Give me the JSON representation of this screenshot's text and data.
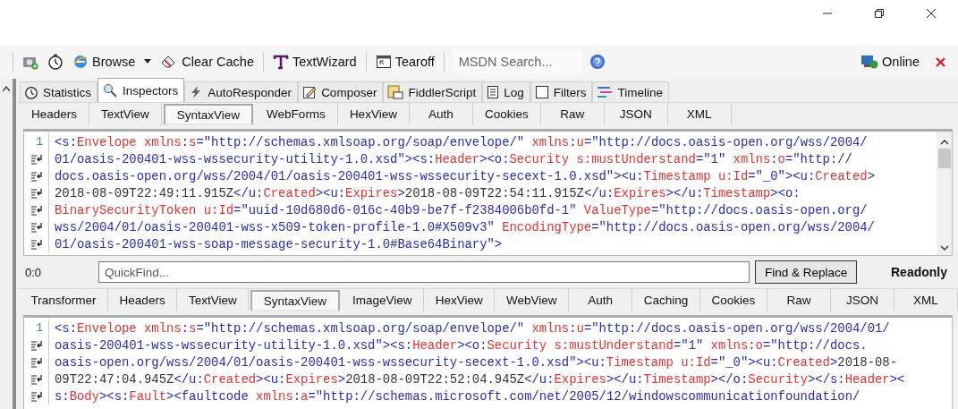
{
  "toolbar": {
    "items": [
      {
        "kind": "icon"
      },
      {
        "kind": "icon"
      },
      {
        "kind": "dropdown",
        "label": "Browse"
      },
      {
        "kind": "button",
        "label": "Clear Cache"
      },
      {
        "kind": "button",
        "label": "TextWizard"
      },
      {
        "kind": "button",
        "label": "Tearoff"
      }
    ],
    "search": {
      "placeholder": "MSDN Search..."
    },
    "status": {
      "label": "Online"
    }
  },
  "main_tabs": [
    {
      "label": "Statistics",
      "selected": false
    },
    {
      "label": "Inspectors",
      "selected": true
    },
    {
      "label": "AutoResponder",
      "selected": false
    },
    {
      "label": "Composer",
      "selected": false
    },
    {
      "label": "FiddlerScript",
      "selected": false
    },
    {
      "label": "Log",
      "selected": false
    },
    {
      "label": "Filters",
      "selected": false
    },
    {
      "label": "Timeline",
      "selected": false
    }
  ],
  "request": {
    "tabs": [
      {
        "label": "Headers",
        "selected": false
      },
      {
        "label": "TextView",
        "selected": false
      },
      {
        "label": "SyntaxView",
        "selected": true
      },
      {
        "label": "WebForms",
        "selected": false
      },
      {
        "label": "HexView",
        "selected": false
      },
      {
        "label": "Auth",
        "selected": false
      },
      {
        "label": "Cookies",
        "selected": false
      },
      {
        "label": "Raw",
        "selected": false
      },
      {
        "label": "JSON",
        "selected": false
      },
      {
        "label": "XML",
        "selected": false
      }
    ],
    "lines": [
      {
        "number": "1",
        "tokens": [
          {
            "kind": "markup",
            "text": "<s:"
          },
          {
            "kind": "name",
            "text": "Envelope xmlns"
          },
          {
            "kind": "markup",
            "text": ":"
          },
          {
            "kind": "name",
            "text": "s"
          },
          {
            "kind": "markup",
            "text": "=\"http://schemas.xmlsoap.org/soap/envelope/\""
          },
          {
            "kind": "name",
            "text": " xmlns"
          },
          {
            "kind": "markup",
            "text": ":"
          },
          {
            "kind": "name",
            "text": "u"
          },
          {
            "kind": "markup",
            "text": "=\"http://docs.oasis-open.org/wss/2004/"
          }
        ]
      },
      {
        "wrapped": true,
        "tokens": [
          {
            "kind": "markup",
            "text": "01/oasis-200401-wss-wssecurity-utility-1.0.xsd\"><s:"
          },
          {
            "kind": "name",
            "text": "Header"
          },
          {
            "kind": "markup",
            "text": "><o:"
          },
          {
            "kind": "name",
            "text": "Security s:mustUnderstand"
          },
          {
            "kind": "markup",
            "text": "=\"1\""
          },
          {
            "kind": "name",
            "text": " xmlns"
          },
          {
            "kind": "markup",
            "text": ":"
          },
          {
            "kind": "name",
            "text": "o"
          },
          {
            "kind": "markup",
            "text": "=\"http://"
          }
        ]
      },
      {
        "wrapped": true,
        "tokens": [
          {
            "kind": "markup",
            "text": "docs.oasis-open.org/wss/2004/01/oasis-200401-wss-wssecurity-secext-1.0.xsd\"><u:"
          },
          {
            "kind": "name",
            "text": "Timestamp u:Id"
          },
          {
            "kind": "markup",
            "text": "=\"_0\"><u:"
          },
          {
            "kind": "name",
            "text": "Created"
          },
          {
            "kind": "markup",
            "text": ">"
          }
        ]
      },
      {
        "wrapped": true,
        "tokens": [
          {
            "kind": "text",
            "text": "2018-08-09T22:49:11.915Z"
          },
          {
            "kind": "markup",
            "text": "</u:"
          },
          {
            "kind": "name",
            "text": "Created"
          },
          {
            "kind": "markup",
            "text": "><u:"
          },
          {
            "kind": "name",
            "text": "Expires"
          },
          {
            "kind": "markup",
            "text": ">"
          },
          {
            "kind": "text",
            "text": "2018-08-09T22:54:11.915Z"
          },
          {
            "kind": "markup",
            "text": "</u:"
          },
          {
            "kind": "name",
            "text": "Expires"
          },
          {
            "kind": "markup",
            "text": "></u:"
          },
          {
            "kind": "name",
            "text": "Timestamp"
          },
          {
            "kind": "markup",
            "text": "><o:"
          }
        ]
      },
      {
        "wrapped": true,
        "tokens": [
          {
            "kind": "name",
            "text": "BinarySecurityToken u:Id"
          },
          {
            "kind": "markup",
            "text": "=\"uuid-10d680d6-016c-40b9-be7f-f2384006b0fd-1\""
          },
          {
            "kind": "name",
            "text": " ValueType"
          },
          {
            "kind": "markup",
            "text": "=\"http://docs.oasis-open.org/"
          }
        ]
      },
      {
        "wrapped": true,
        "tokens": [
          {
            "kind": "markup",
            "text": "wss/2004/01/oasis-200401-wss-x509-token-profile-1.0#X509v3\""
          },
          {
            "kind": "name",
            "text": " EncodingType"
          },
          {
            "kind": "markup",
            "text": "=\"http://docs.oasis-open.org/wss/2004/"
          }
        ]
      },
      {
        "wrapped": true,
        "tokens": [
          {
            "kind": "markup",
            "text": "01/oasis-200401-wss-soap-message-security-1.0#Base64Binary\">"
          }
        ]
      }
    ],
    "position": "0:0",
    "quickfind": {
      "placeholder": "QuickFind..."
    },
    "find_button": "Find & Replace",
    "mode": "Readonly"
  },
  "response": {
    "tabs": [
      {
        "label": "Transformer",
        "selected": false
      },
      {
        "label": "Headers",
        "selected": false
      },
      {
        "label": "TextView",
        "selected": false
      },
      {
        "label": "SyntaxView",
        "selected": true
      },
      {
        "label": "ImageView",
        "selected": false
      },
      {
        "label": "HexView",
        "selected": false
      },
      {
        "label": "WebView",
        "selected": false
      },
      {
        "label": "Auth",
        "selected": false
      },
      {
        "label": "Caching",
        "selected": false
      },
      {
        "label": "Cookies",
        "selected": false
      },
      {
        "label": "Raw",
        "selected": false
      },
      {
        "label": "JSON",
        "selected": false
      },
      {
        "label": "XML",
        "selected": false
      }
    ],
    "lines": [
      {
        "number": "1",
        "tokens": [
          {
            "kind": "markup",
            "text": "<s:"
          },
          {
            "kind": "name",
            "text": "Envelope xmlns"
          },
          {
            "kind": "markup",
            "text": ":"
          },
          {
            "kind": "name",
            "text": "s"
          },
          {
            "kind": "markup",
            "text": "=\"http://schemas.xmlsoap.org/soap/envelope/\""
          },
          {
            "kind": "name",
            "text": " xmlns"
          },
          {
            "kind": "markup",
            "text": ":"
          },
          {
            "kind": "name",
            "text": "u"
          },
          {
            "kind": "markup",
            "text": "=\"http://docs.oasis-open.org/wss/2004/01/"
          }
        ]
      },
      {
        "wrapped": true,
        "tokens": [
          {
            "kind": "markup",
            "text": "oasis-200401-wss-wssecurity-utility-1.0.xsd\"><s:"
          },
          {
            "kind": "name",
            "text": "Header"
          },
          {
            "kind": "markup",
            "text": "><o:"
          },
          {
            "kind": "name",
            "text": "Security s:mustUnderstand"
          },
          {
            "kind": "markup",
            "text": "=\"1\""
          },
          {
            "kind": "name",
            "text": " xmlns"
          },
          {
            "kind": "markup",
            "text": ":"
          },
          {
            "kind": "name",
            "text": "o"
          },
          {
            "kind": "markup",
            "text": "=\"http://docs."
          }
        ]
      },
      {
        "wrapped": true,
        "tokens": [
          {
            "kind": "markup",
            "text": "oasis-open.org/wss/2004/01/oasis-200401-wss-wssecurity-secext-1.0.xsd\"><u:"
          },
          {
            "kind": "name",
            "text": "Timestamp u:Id"
          },
          {
            "kind": "markup",
            "text": "=\"_0\"><u:"
          },
          {
            "kind": "name",
            "text": "Created"
          },
          {
            "kind": "markup",
            "text": ">"
          },
          {
            "kind": "text",
            "text": "2018-08-"
          }
        ]
      },
      {
        "wrapped": true,
        "tokens": [
          {
            "kind": "text",
            "text": "09T22:47:04.945Z"
          },
          {
            "kind": "markup",
            "text": "</u:"
          },
          {
            "kind": "name",
            "text": "Created"
          },
          {
            "kind": "markup",
            "text": "><u:"
          },
          {
            "kind": "name",
            "text": "Expires"
          },
          {
            "kind": "markup",
            "text": ">"
          },
          {
            "kind": "text",
            "text": "2018-08-09T22:52:04.945Z"
          },
          {
            "kind": "markup",
            "text": "</u:"
          },
          {
            "kind": "name",
            "text": "Expires"
          },
          {
            "kind": "markup",
            "text": "></u:"
          },
          {
            "kind": "name",
            "text": "Timestamp"
          },
          {
            "kind": "markup",
            "text": "></o:"
          },
          {
            "kind": "name",
            "text": "Security"
          },
          {
            "kind": "markup",
            "text": "></s:"
          },
          {
            "kind": "name",
            "text": "Header"
          },
          {
            "kind": "markup",
            "text": "><"
          }
        ]
      },
      {
        "wrapped": true,
        "tokens": [
          {
            "kind": "markup",
            "text": "s:"
          },
          {
            "kind": "name",
            "text": "Body"
          },
          {
            "kind": "markup",
            "text": "><s:"
          },
          {
            "kind": "name",
            "text": "Fault"
          },
          {
            "kind": "markup",
            "text": "><faultcode"
          },
          {
            "kind": "name",
            "text": " xmlns"
          },
          {
            "kind": "markup",
            "text": ":"
          },
          {
            "kind": "name",
            "text": "a"
          },
          {
            "kind": "markup",
            "text": "=\"http://schemas.microsoft.com/net/2005/12/windowscommunicationfoundation/"
          }
        ]
      }
    ]
  }
}
